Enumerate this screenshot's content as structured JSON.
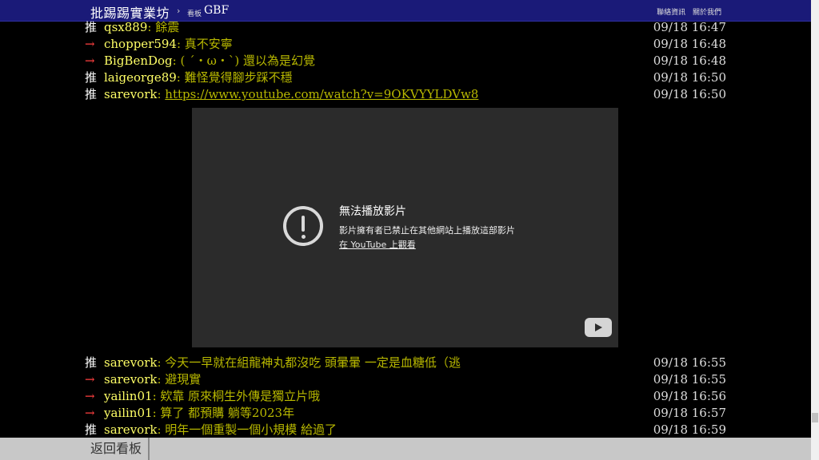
{
  "header": {
    "site_title": "批踢踢實業坊",
    "separator": "›",
    "board_label": "看板",
    "board_name": "GBF",
    "links": [
      "聯絡資訊",
      "關於我們"
    ]
  },
  "pushes_top": [
    {
      "tag": "推",
      "user": "qsx889",
      "content": ": 餘震",
      "time": "09/18 16:47"
    },
    {
      "tag": "→",
      "user": "chopper594",
      "content": ": 真不安寧",
      "time": "09/18 16:48"
    },
    {
      "tag": "→",
      "user": "BigBenDog",
      "content": ": ( ˊ・ω・ˋ) 還以為是幻覺",
      "time": "09/18 16:48"
    },
    {
      "tag": "推",
      "user": "laigeorge89",
      "content": ": 難怪覺得腳步踩不穩",
      "time": "09/18 16:50"
    },
    {
      "tag": "推",
      "user": "sarevork",
      "content_prefix": ": ",
      "link": "https://www.youtube.com/watch?v=9OKVYYLDVw8",
      "time": "09/18 16:50"
    }
  ],
  "video": {
    "title": "無法播放影片",
    "message": "影片擁有者已禁止在其他網站上播放這部影片",
    "link_text": "在 YouTube 上觀看"
  },
  "pushes_bottom": [
    {
      "tag": "推",
      "user": "sarevork",
      "content": ": 今天一早就在組龍神丸都沒吃 頭暈暈 一定是血糖低（逃",
      "time": "09/18 16:55"
    },
    {
      "tag": "→",
      "user": "sarevork",
      "content": ": 避現實",
      "time": "09/18 16:55"
    },
    {
      "tag": "→",
      "user": "yailin01",
      "content": ": 欸靠 原來桐生外傳是獨立片哦",
      "time": "09/18 16:56"
    },
    {
      "tag": "→",
      "user": "yailin01",
      "content": ": 算了 都預購 躺等2023年",
      "time": "09/18 16:57"
    },
    {
      "tag": "推",
      "user": "sarevork",
      "content": ": 明年一個重製一個小規模 給過了",
      "time": "09/18 16:59"
    }
  ],
  "footer": {
    "back_label": "返回看板"
  }
}
